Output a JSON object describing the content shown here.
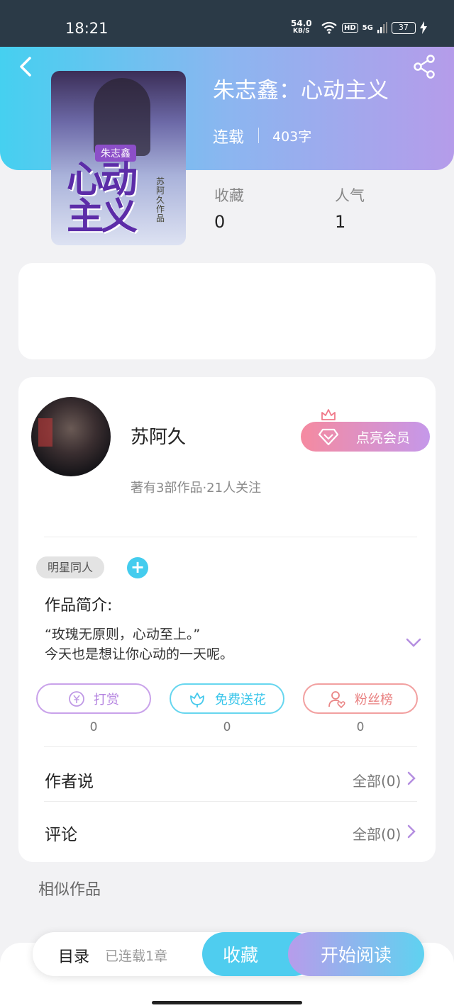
{
  "status_bar": {
    "time": "18:21",
    "net_speed_value": "54.0",
    "net_speed_unit": "KB/S",
    "hd_label": "HD",
    "signal_label": "5G",
    "battery": "37"
  },
  "book": {
    "title": "朱志鑫：心动主义",
    "status": "连载",
    "word_count": "403字",
    "cover_tag": "朱志鑫",
    "cover_title": "心动主义",
    "cover_author": "苏阿久作品"
  },
  "stats": [
    {
      "label": "收藏",
      "value": "0"
    },
    {
      "label": "人气",
      "value": "1"
    }
  ],
  "author": {
    "name": "苏阿久",
    "meta": "著有3部作品·21人关注",
    "vip_button": "点亮会员"
  },
  "tags": {
    "items": [
      "明星同人"
    ],
    "add_symbol": "+"
  },
  "intro": {
    "title": "作品简介:",
    "lines": [
      "“玫瑰无原则，心动至上。”",
      "今天也是想让你心动的一天呢。"
    ]
  },
  "actions": [
    {
      "label": "打赏",
      "count": "0"
    },
    {
      "label": "免费送花",
      "count": "0"
    },
    {
      "label": "粉丝榜",
      "count": "0"
    }
  ],
  "rows": [
    {
      "label": "作者说",
      "right": "全部(0)"
    },
    {
      "label": "评论",
      "right": "全部(0)"
    }
  ],
  "similar_title": "相似作品",
  "bottom_bar": {
    "toc_label": "目录",
    "toc_sub": "已连载1章",
    "collect_label": "收藏",
    "read_label": "开始阅读"
  },
  "colors": {
    "header_gradient_start": "#45d0f0",
    "header_gradient_end": "#b59cea",
    "accent_cyan": "#44ccee",
    "vip_gradient_start": "#f58aa0",
    "vip_gradient_end": "#c598ea"
  },
  "icons": {
    "back": "back-arrow-icon",
    "share": "share-icon",
    "crown": "crown-icon",
    "diamond": "diamond-icon",
    "yen": "yen-coin-icon",
    "flower": "flower-icon",
    "fans": "user-heart-icon",
    "expand": "chevron-down-icon",
    "row_arrow": "chevron-right-icon"
  }
}
